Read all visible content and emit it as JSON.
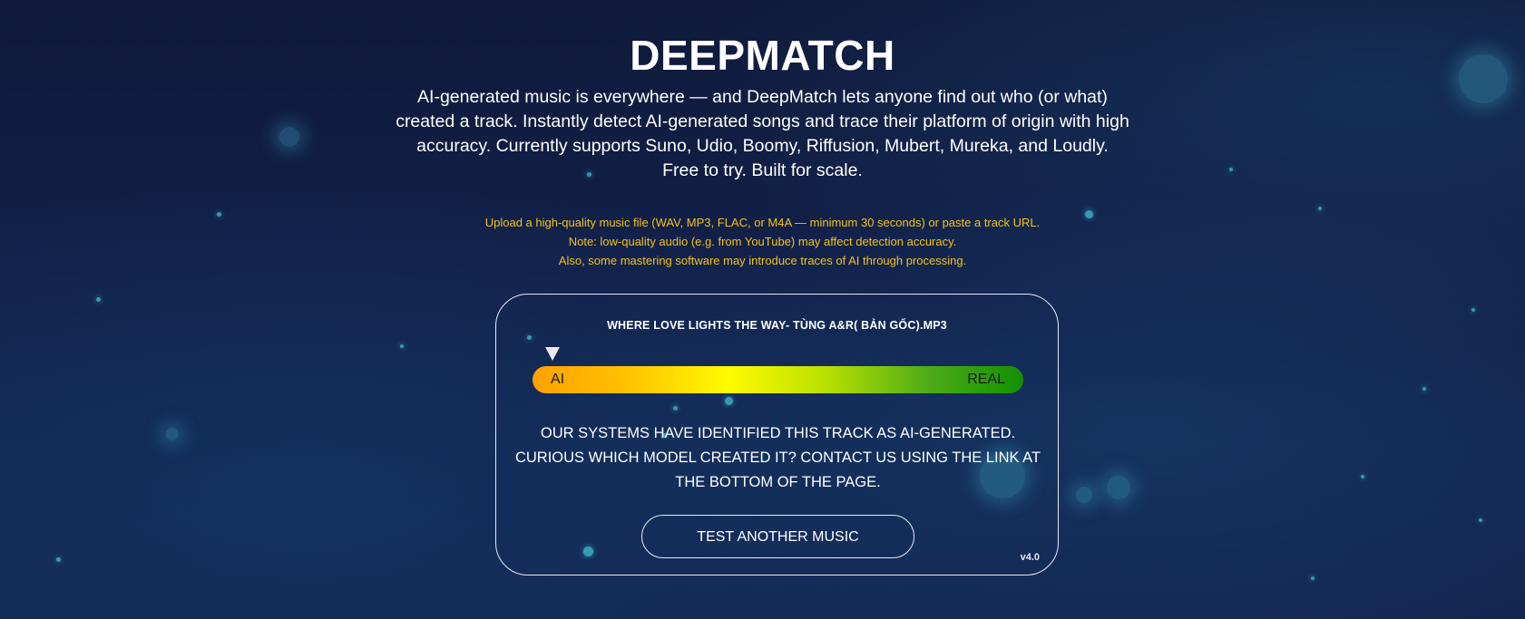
{
  "app": {
    "title": "DEEPMATCH"
  },
  "intro": {
    "lines": [
      "AI-generated music is everywhere — and DeepMatch lets anyone find out who (or what)",
      "created a track. Instantly detect AI-generated songs and trace their platform of origin with high",
      "accuracy. Currently supports Suno, Udio, Boomy, Riffusion, Mubert, Mureka, and Loudly.",
      "Free to try. Built for scale."
    ]
  },
  "notice": {
    "color": "#f2c21a",
    "lines": [
      "Upload a high-quality music file (WAV, MP3, FLAC, or M4A — minimum 30 seconds) or paste a track URL.",
      "Note: low-quality audio (e.g. from YouTube) may affect detection accuracy.",
      "Also, some mastering software may introduce traces of AI through processing."
    ]
  },
  "result_card": {
    "file_name": "WHERE LOVE LIGHTS THE WAY- TÙNG A&R( BẢN GỐC).MP3",
    "meter": {
      "left_label": "AI",
      "right_label": "REAL",
      "marker_icon": "triangle-down-icon",
      "gradient_colors": [
        "#ffa000",
        "#ffc400",
        "#fffb00",
        "#b8e000",
        "#4fad18",
        "#129000"
      ],
      "value": 0.04
    },
    "message_lines": [
      "OUR SYSTEMS HAVE IDENTIFIED THIS TRACK AS AI-GENERATED.",
      "CURIOUS WHICH MODEL CREATED IT? CONTACT US USING THE LINK AT",
      "THE BOTTOM OF THE PAGE."
    ],
    "test_another_label": "TEST ANOTHER MUSIC",
    "version": "v4.0"
  }
}
